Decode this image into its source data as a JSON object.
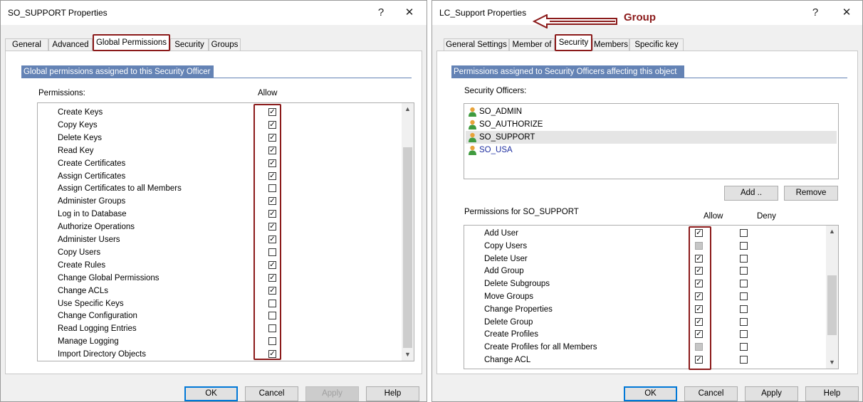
{
  "left": {
    "title": "SO_SUPPORT Properties",
    "help_glyph": "?",
    "close_glyph": "✕",
    "tabs": [
      "General",
      "Advanced",
      "Global Permissions",
      "Security",
      "Groups"
    ],
    "section_header": "Global permissions assigned to this Security Officer",
    "col_permissions": "Permissions:",
    "col_allow": "Allow",
    "permissions": [
      {
        "name": "Create Keys",
        "allow": true
      },
      {
        "name": "Copy Keys",
        "allow": true
      },
      {
        "name": "Delete Keys",
        "allow": true
      },
      {
        "name": "Read Key",
        "allow": true
      },
      {
        "name": "Create Certificates",
        "allow": true
      },
      {
        "name": "Assign Certificates",
        "allow": true
      },
      {
        "name": "Assign Certificates to all Members",
        "allow": false
      },
      {
        "name": "Administer Groups",
        "allow": true
      },
      {
        "name": "Log in to Database",
        "allow": true
      },
      {
        "name": "Authorize Operations",
        "allow": true
      },
      {
        "name": "Administer Users",
        "allow": true
      },
      {
        "name": "Copy Users",
        "allow": false
      },
      {
        "name": "Create Rules",
        "allow": true
      },
      {
        "name": "Change Global Permissions",
        "allow": true
      },
      {
        "name": "Change ACLs",
        "allow": true
      },
      {
        "name": "Use Specific Keys",
        "allow": false
      },
      {
        "name": "Change Configuration",
        "allow": false
      },
      {
        "name": "Read Logging Entries",
        "allow": false
      },
      {
        "name": "Manage Logging",
        "allow": false
      },
      {
        "name": "Import Directory Objects",
        "allow": true
      }
    ],
    "buttons": {
      "ok": "OK",
      "cancel": "Cancel",
      "apply": "Apply",
      "help": "Help"
    }
  },
  "right": {
    "title": "LC_Support Properties",
    "annotation": "Group",
    "help_glyph": "?",
    "close_glyph": "✕",
    "tabs": [
      "General Settings",
      "Member of",
      "Security",
      "Members",
      "Specific key"
    ],
    "section_header": "Permissions assigned to Security Officers affecting this object",
    "security_officers_label": "Security Officers:",
    "officers": [
      {
        "name": "SO_ADMIN",
        "selected": false,
        "color": "#000000"
      },
      {
        "name": "SO_AUTHORIZE",
        "selected": false,
        "color": "#000000"
      },
      {
        "name": "SO_SUPPORT",
        "selected": true,
        "color": "#000000"
      },
      {
        "name": "SO_USA",
        "selected": false,
        "color": "#1f2fa0"
      }
    ],
    "add_button": "Add ..",
    "remove_button": "Remove",
    "perm_label": "Permissions for SO_SUPPORT",
    "col_allow": "Allow",
    "col_deny": "Deny",
    "permissions": [
      {
        "name": "Add User",
        "allow": "checked",
        "deny": false
      },
      {
        "name": "Copy Users",
        "allow": "disabled",
        "deny": false
      },
      {
        "name": "Delete User",
        "allow": "checked",
        "deny": false
      },
      {
        "name": "Add Group",
        "allow": "checked",
        "deny": false
      },
      {
        "name": "Delete Subgroups",
        "allow": "checked",
        "deny": false
      },
      {
        "name": "Move Groups",
        "allow": "checked",
        "deny": false
      },
      {
        "name": "Change Properties",
        "allow": "checked",
        "deny": false
      },
      {
        "name": "Delete Group",
        "allow": "checked",
        "deny": false
      },
      {
        "name": "Create Profiles",
        "allow": "checked",
        "deny": false
      },
      {
        "name": "Create Profiles for all Members",
        "allow": "disabled",
        "deny": false
      },
      {
        "name": "Change ACL",
        "allow": "checked",
        "deny": false
      }
    ],
    "buttons": {
      "ok": "OK",
      "cancel": "Cancel",
      "apply": "Apply",
      "help": "Help"
    }
  },
  "colors": {
    "highlight": "#8b1a1a",
    "section_header": "#6483b5",
    "focus": "#0078d7"
  }
}
